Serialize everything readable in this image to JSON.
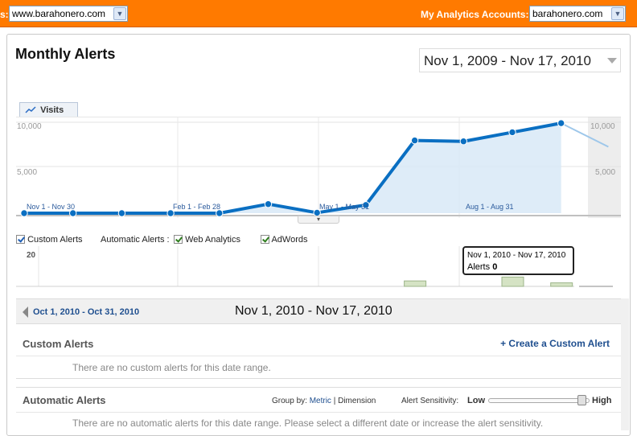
{
  "topbar": {
    "left_label_fragment": "s:",
    "profile_value": "www.barahonero.com",
    "accounts_label": "My Analytics Accounts:",
    "accounts_value": "barahonero.com"
  },
  "page": {
    "title": "Monthly Alerts",
    "date_range": "Nov 1, 2009 - Nov 17, 2010"
  },
  "graph": {
    "tab_label": "Visits",
    "y_ticks": [
      "10,000",
      "5,000"
    ],
    "y_ticks_right": [
      "10,000",
      "5,000"
    ],
    "period_labels": [
      "Nov 1 - Nov 30",
      "Feb 1 - Feb 28",
      "May 1 - May 31",
      "Aug 1 - Aug 31"
    ]
  },
  "chart_data": {
    "type": "area",
    "series": [
      {
        "name": "Visits",
        "x": [
          "Nov 2009",
          "Dec 2009",
          "Jan 2010",
          "Feb 2010",
          "Mar 2010",
          "Apr 2010",
          "May 2010",
          "Jun 2010",
          "Jul 2010",
          "Aug 2010",
          "Sep 2010",
          "Oct 2010",
          "Nov 2010"
        ],
        "values": [
          0,
          0,
          0,
          0,
          0,
          1000,
          50,
          900,
          8000,
          7900,
          8900,
          9900,
          7300
        ]
      }
    ],
    "ylim": [
      0,
      10000
    ],
    "ylabel": "",
    "xlabel": ""
  },
  "legend": {
    "custom_alerts": "Custom Alerts",
    "automatic_alerts": "Automatic Alerts :",
    "web_analytics": "Web Analytics",
    "adwords": "AdWords"
  },
  "alerts_chart": {
    "y_tick": "20",
    "values": [
      0,
      0,
      0,
      0,
      0,
      0,
      0,
      0,
      2,
      0,
      4,
      1
    ]
  },
  "tooltip": {
    "range": "Nov 1, 2010 - Nov 17, 2010",
    "alerts_label": "Alerts",
    "alerts_value": "0"
  },
  "nav": {
    "prev_range": "Oct 1, 2010 - Oct 31, 2010",
    "current_range": "Nov 1, 2010 - Nov 17, 2010"
  },
  "custom_section": {
    "heading": "Custom Alerts",
    "create_link": "+ Create a Custom Alert",
    "empty_message": "There are no custom alerts for this date range."
  },
  "automatic_section": {
    "heading": "Automatic Alerts",
    "group_by_label": "Group by:",
    "group_by_metric": "Metric",
    "group_by_sep": "|",
    "group_by_dimension": "Dimension",
    "sensitivity_label": "Alert Sensitivity:",
    "sensitivity_low": "Low",
    "sensitivity_high": "High",
    "empty_message": "There are no automatic alerts for this date range. Please select a different date or increase the alert sensitivity."
  },
  "colors": {
    "topbar": "#ff7a00",
    "line": "#0a6fc2",
    "area": "#d8e9f7",
    "alert_bar": "#d5e3c4"
  }
}
